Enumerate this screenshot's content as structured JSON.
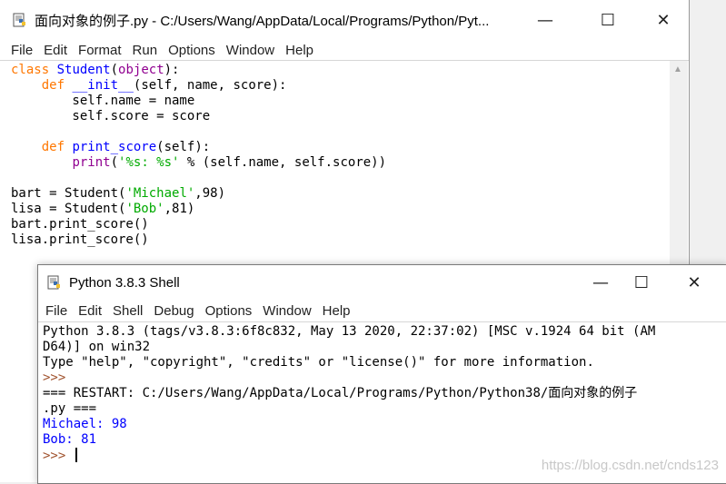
{
  "editor": {
    "title": "面向对象的例子.py - C:/Users/Wang/AppData/Local/Programs/Python/Pyt...",
    "menu": [
      "File",
      "Edit",
      "Format",
      "Run",
      "Options",
      "Window",
      "Help"
    ],
    "code": {
      "l1": [
        "class",
        " ",
        "Student",
        "(",
        "object",
        "):"
      ],
      "l2": [
        "    ",
        "def",
        " ",
        "__init__",
        "(self, name, score):"
      ],
      "l3": "        self.name = name",
      "l4": "        self.score = score",
      "l6": [
        "    ",
        "def",
        " ",
        "print_score",
        "(self):"
      ],
      "l7": [
        "        ",
        "print",
        "(",
        "'%s: %s'",
        " % (self.name, self.score))"
      ],
      "l9": [
        "bart = Student(",
        "'Michael'",
        ",98)"
      ],
      "l10": [
        "lisa = Student(",
        "'Bob'",
        ",81)"
      ],
      "l11": "bart.print_score()",
      "l12": "lisa.print_score()"
    }
  },
  "shell": {
    "title": "Python 3.8.3 Shell",
    "menu": [
      "File",
      "Edit",
      "Shell",
      "Debug",
      "Options",
      "Window",
      "Help"
    ],
    "lines": {
      "l1": "Python 3.8.3 (tags/v3.8.3:6f8c832, May 13 2020, 22:37:02) [MSC v.1924 64 bit (AM",
      "l2": "D64)] on win32",
      "l3": "Type \"help\", \"copyright\", \"credits\" or \"license()\" for more information.",
      "l4": ">>> ",
      "l5": "=== RESTART: C:/Users/Wang/AppData/Local/Programs/Python/Python38/面向对象的例子",
      "l6": ".py ===",
      "l7": "Michael: 98",
      "l8": "Bob: 81",
      "l9": ">>> "
    }
  },
  "window_controls": {
    "minimize": "—",
    "maximize": "☐",
    "close": "✕"
  },
  "watermark": "https://blog.csdn.net/cnds123",
  "colors": {
    "keyword": "#ff7700",
    "builtin": "#900090",
    "definition": "#0000ff",
    "string": "#00aa00",
    "prompt": "#a0522d",
    "stdout": "#0000ff"
  },
  "icons": {
    "app": "python-idle-icon"
  }
}
